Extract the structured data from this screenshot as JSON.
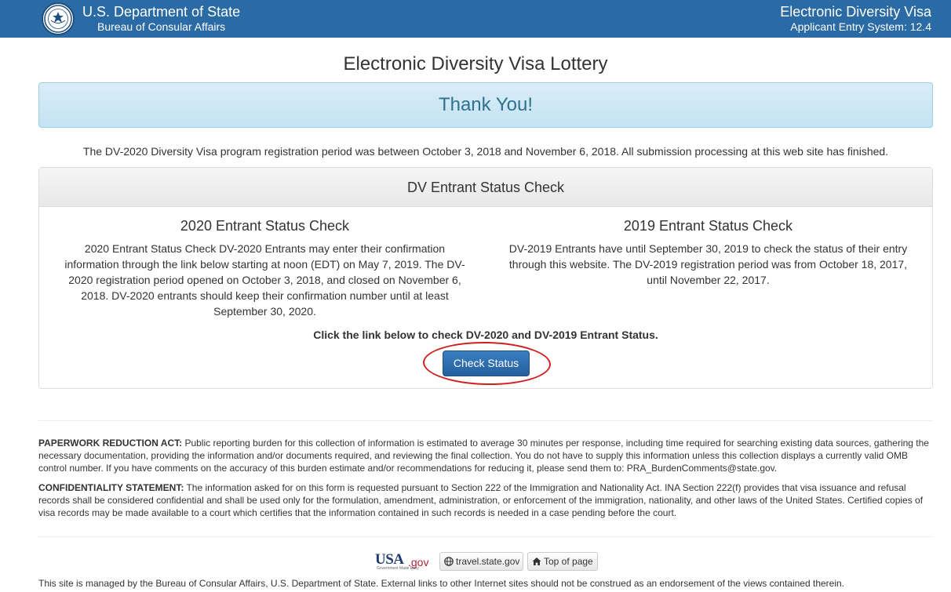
{
  "header": {
    "agency": "U.S. Department of State",
    "bureau": "Bureau of Consular Affairs",
    "system_title": "Electronic Diversity Visa",
    "system_version": "Applicant Entry System: 12.4",
    "seal_icon": "state-department-seal-icon",
    "bar_color": "#2a6aa5"
  },
  "page_title": "Electronic Diversity Visa Lottery",
  "thank_you": "Thank You!",
  "period_notice": "The DV-2020 Diversity Visa program registration period was between October 3, 2018 and November 6, 2018. All submission processing at this web site has finished.",
  "status_panel": {
    "heading": "DV Entrant Status Check",
    "left": {
      "title": "2020 Entrant Status Check",
      "body": "2020 Entrant Status Check DV-2020 Entrants may enter their confirmation information through the link below starting at noon (EDT) on May 7, 2019. The DV-2020 registration period opened on October 3, 2018, and closed on November 6, 2018. DV-2020 entrants should keep their confirmation number until at least September 30, 2020."
    },
    "right": {
      "title": "2019 Entrant Status Check",
      "body": "DV-2019 Entrants have until September 30, 2019 to check the status of their entry through this website. The DV-2019 registration period was from October 18, 2017, until November 22, 2017."
    },
    "instruction": "Click the link below to check DV-2020 and DV-2019 Entrant Status.",
    "button_label": "Check Status",
    "highlight_color": "#d01f1f"
  },
  "legal": {
    "paperwork_label": "PAPERWORK REDUCTION ACT:",
    "paperwork_text": " Public reporting burden for this collection of information is estimated to average 30 minutes per response, including time required for searching existing data sources, gathering the necessary documentation, providing the information and/or documents required, and reviewing the final collection. You do not have to supply this information unless this collection displays a currently valid OMB control number. If you have comments on the accuracy of this burden estimate and/or recommendations for reducing it, please send them to: PRA_BurdenComments@state.gov.",
    "confidentiality_label": "CONFIDENTIALITY STATEMENT:",
    "confidentiality_text": " The information asked for on this form is requested pursuant to Section 222 of the Immigration and Nationality Act. INA Section 222(f) provides that visa issuance and refusal records shall be considered confidential and shall be used only for the formulation, amendment, administration, or enforcement of the immigration, nationality, and other laws of the United States. Certified copies of visa records may be made available to a court which certifies that the information contained in such records is needed in a case pending before the court."
  },
  "footer": {
    "usa_logo_mark": "USA",
    "usa_logo_gov": ".gov",
    "usa_logo_sub": "Government Made Easy",
    "travel_link": "travel.state.gov",
    "travel_icon": "globe-icon",
    "top_link": "Top of page",
    "top_icon": "home-icon",
    "disclaimer": "This site is managed by the Bureau of Consular Affairs, U.S. Department of State. External links to other Internet sites should not be construed as an endorsement of the views contained therein."
  }
}
